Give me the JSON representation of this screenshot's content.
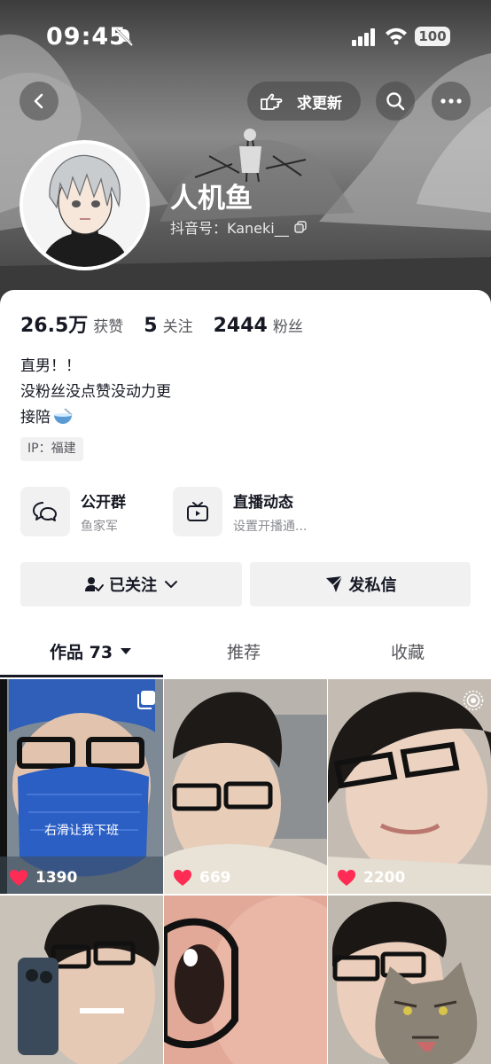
{
  "status_bar": {
    "time": "09:45",
    "battery": "100"
  },
  "header": {
    "update_label": "求更新",
    "username": "人机鱼",
    "douyin_id": "抖音号：Kaneki__"
  },
  "stats": [
    {
      "num": "26.5万",
      "label": "获赞"
    },
    {
      "num": "5",
      "label": "关注"
    },
    {
      "num": "2444",
      "label": "粉丝"
    }
  ],
  "bio": {
    "line1": "直男！！",
    "line2": "没粉丝没点赞没动力更",
    "line3": "接陪"
  },
  "ip": "IP：福建",
  "features": {
    "group": {
      "title": "公开群",
      "sub": "鱼家军"
    },
    "live": {
      "title": "直播动态",
      "sub": "设置开播通..."
    }
  },
  "actions": {
    "follow": "已关注",
    "message": "发私信"
  },
  "tabs": {
    "works": "作品 73",
    "recommend": "推荐",
    "favorites": "收藏"
  },
  "videos": [
    {
      "likes": "1390",
      "caption": "右滑让我下班",
      "badge": "multi-image-icon"
    },
    {
      "likes": "669"
    },
    {
      "likes": "2200",
      "badge": "live-photo-icon"
    },
    {
      "likes": ""
    },
    {
      "likes": ""
    },
    {
      "likes": ""
    }
  ],
  "colors": {
    "text": "#161823",
    "secondary": "#57585d",
    "chip": "#f1f1f2",
    "heart": "#fe2c55"
  }
}
